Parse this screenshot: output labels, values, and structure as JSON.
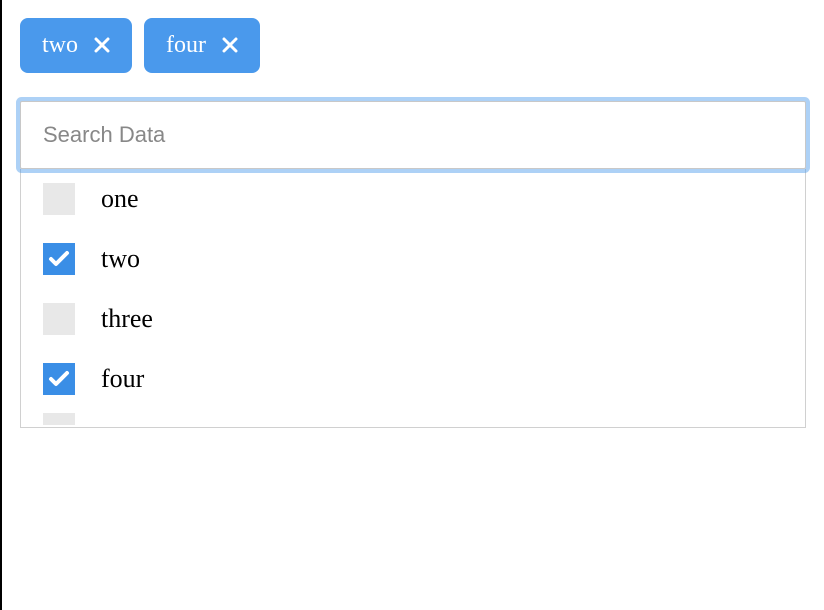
{
  "tags": [
    {
      "label": "two"
    },
    {
      "label": "four"
    }
  ],
  "search": {
    "placeholder": "Search Data",
    "value": ""
  },
  "options": [
    {
      "label": "one",
      "checked": false
    },
    {
      "label": "two",
      "checked": true
    },
    {
      "label": "three",
      "checked": false
    },
    {
      "label": "four",
      "checked": true
    }
  ],
  "colors": {
    "accent": "#4a99ec",
    "checkbox_checked": "#3a8ee6",
    "checkbox_unchecked": "#e8e8e8"
  }
}
